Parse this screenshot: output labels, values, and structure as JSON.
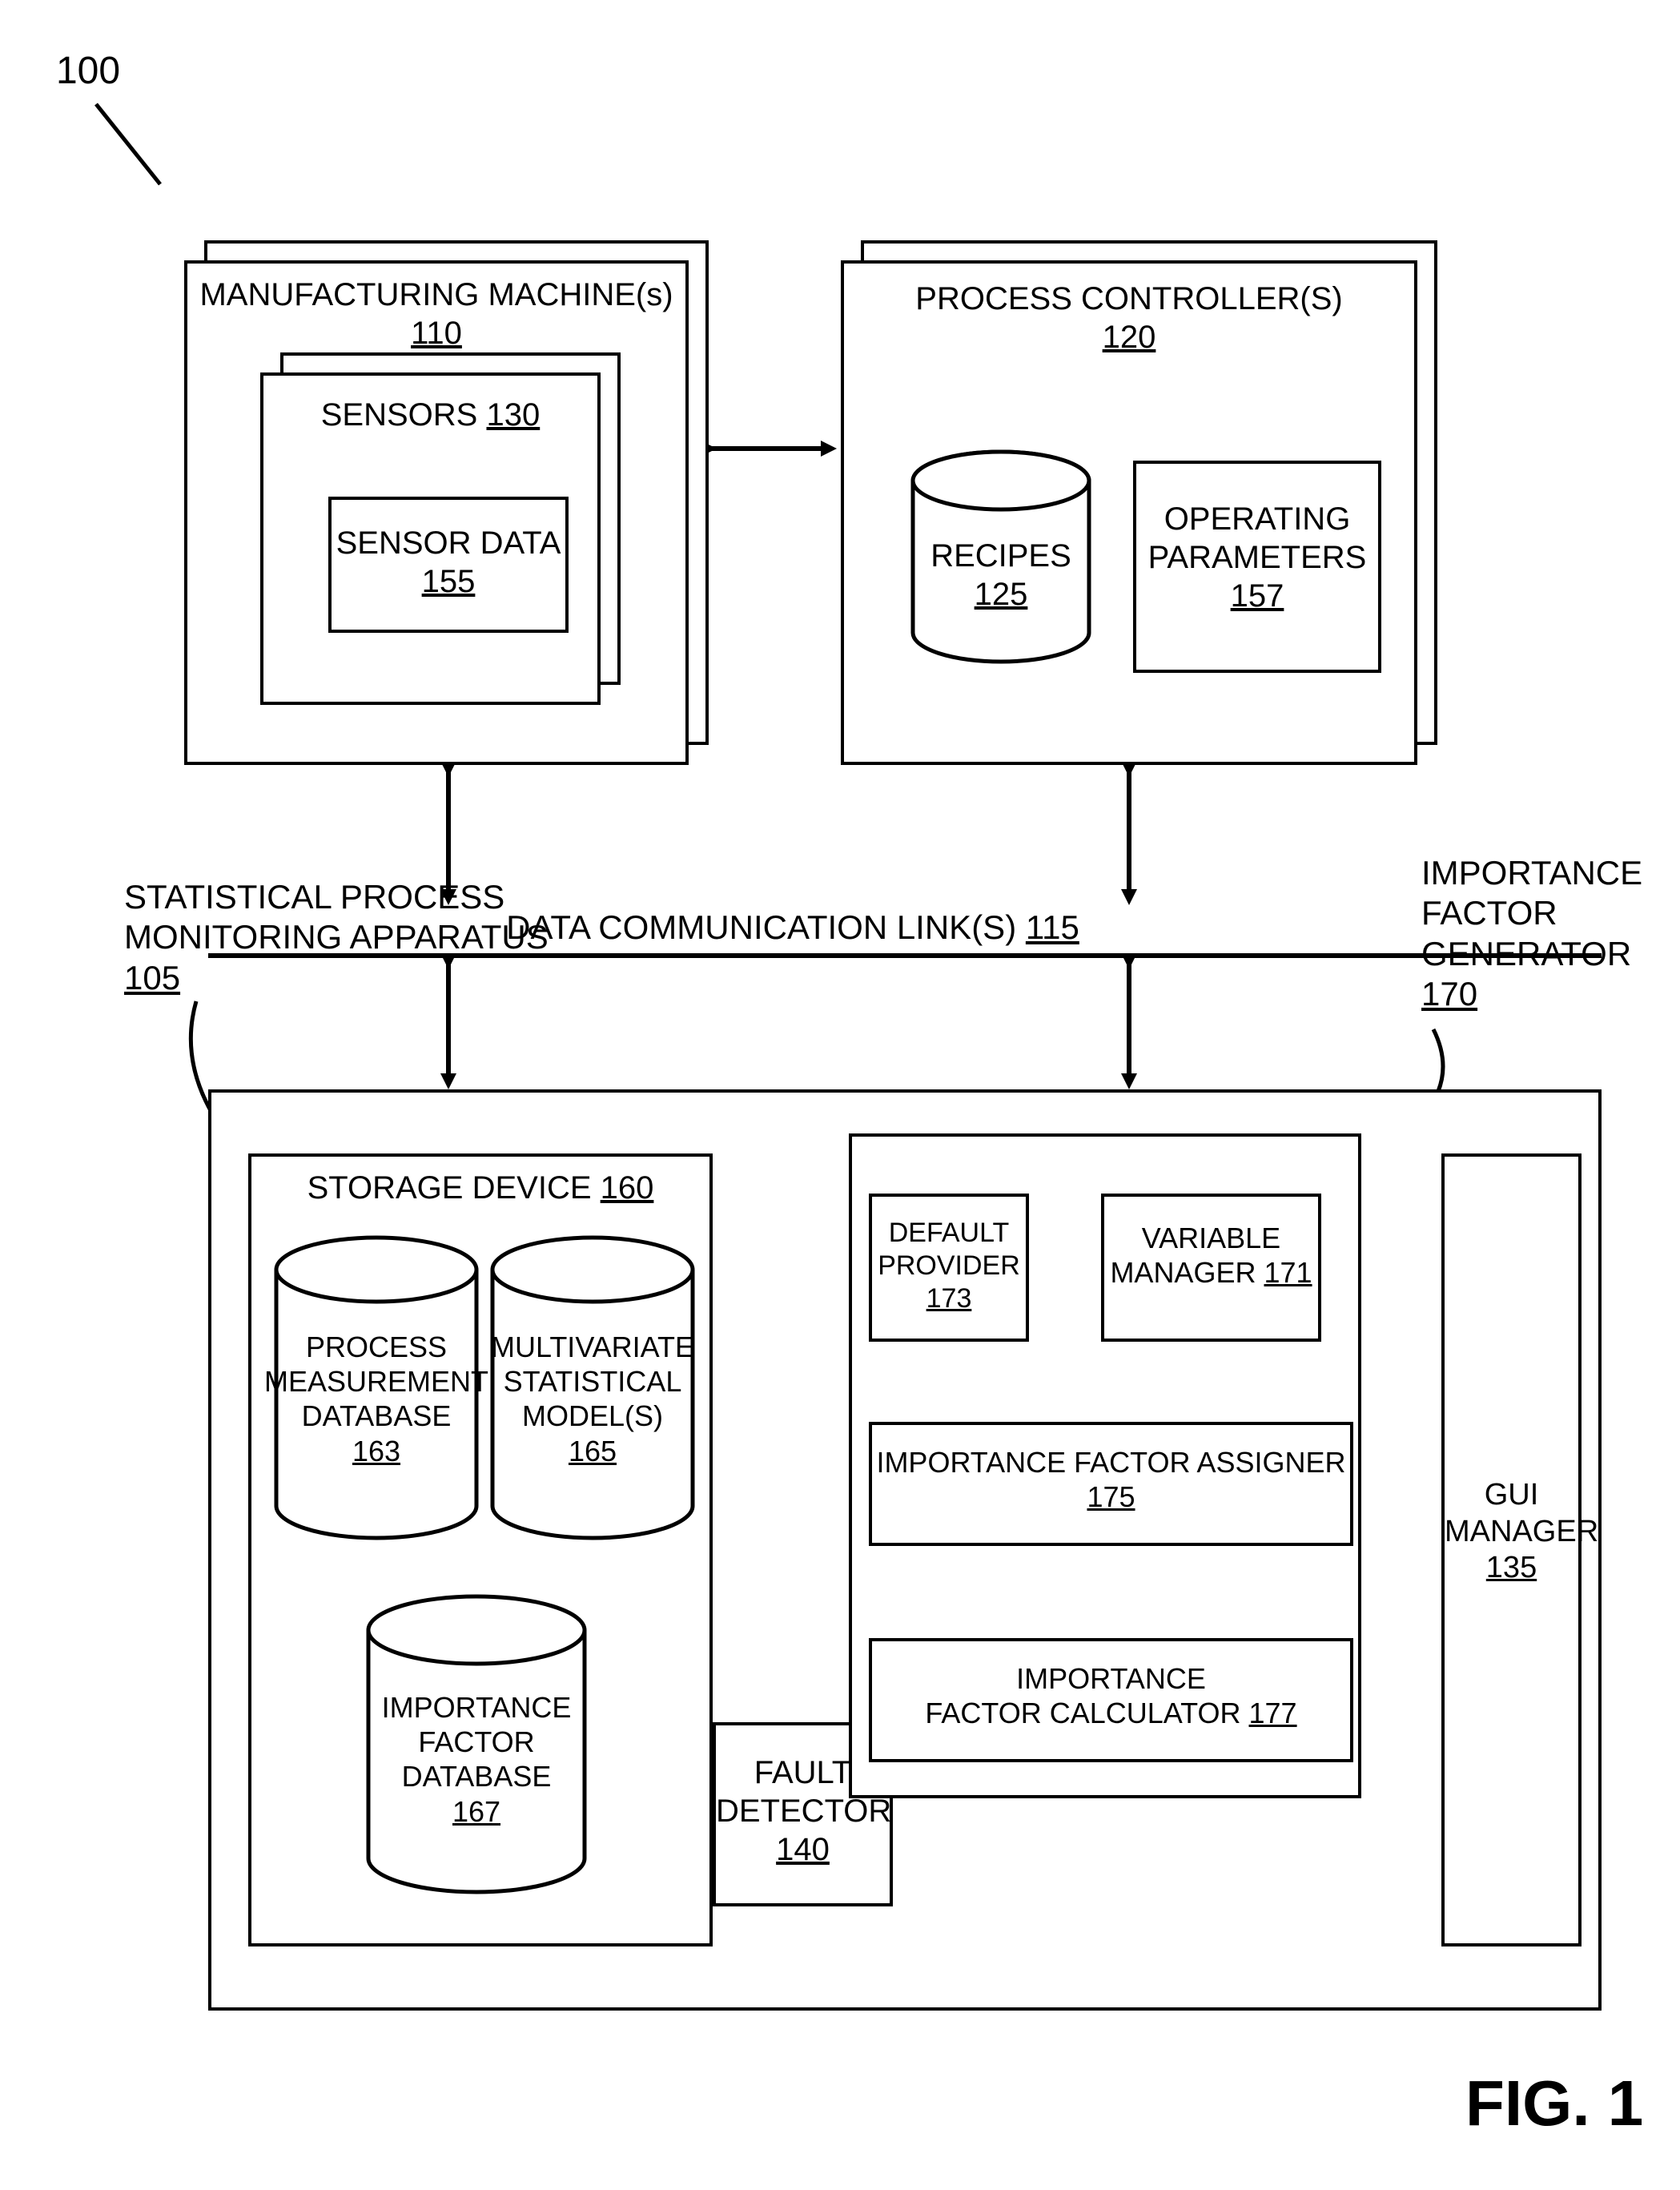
{
  "figure": {
    "ref_number": "100",
    "caption": "FIG. 1"
  },
  "manufacturing_machine": {
    "title_line1": "MANUFACTURING MACHINE(s)",
    "title_ref": "110",
    "sensors": {
      "line1": "SENSORS",
      "ref": "130"
    },
    "sensor_data": {
      "line1": "SENSOR DATA",
      "ref": "155"
    }
  },
  "process_controller": {
    "title": "PROCESS CONTROLLER(S)",
    "ref": "120",
    "recipes": {
      "label": "RECIPES",
      "ref": "125"
    },
    "operating_params": {
      "line1": "OPERATING",
      "line2": "PARAMETERS",
      "ref": "157"
    }
  },
  "link": {
    "label": "DATA COMMUNICATION LINK(S)",
    "ref": "115"
  },
  "spm": {
    "label_line1": "STATISTICAL PROCESS",
    "label_line2": "MONITORING APPARATUS",
    "ref": "105"
  },
  "ifg_callout": {
    "line1": "IMPORTANCE",
    "line2": "FACTOR",
    "line3": "GENERATOR",
    "ref": "170"
  },
  "storage": {
    "title": "STORAGE DEVICE",
    "ref": "160",
    "pmd": {
      "l1": "PROCESS",
      "l2": "MEASUREMENT",
      "l3": "DATABASE",
      "ref": "163"
    },
    "msm": {
      "l1": "MULTIVARIATE",
      "l2": "STATISTICAL",
      "l3": "MODEL(S)",
      "ref": "165"
    },
    "ifd": {
      "l1": "IMPORTANCE",
      "l2": "FACTOR",
      "l3": "DATABASE",
      "ref": "167"
    }
  },
  "fault_detector": {
    "l1": "FAULT",
    "l2": "DETECTOR",
    "ref": "140"
  },
  "ifg_box": {
    "variable_manager": {
      "l1": "VARIABLE",
      "l2": "MANAGER",
      "ref": "171"
    },
    "default_provider": {
      "l1": "DEFAULT",
      "l2": "PROVIDER",
      "ref": "173"
    },
    "if_assigner": {
      "l1": "IMPORTANCE FACTOR ASSIGNER",
      "ref": "175"
    },
    "if_calculator": {
      "l1": "IMPORTANCE",
      "l2": "FACTOR CALCULATOR",
      "ref": "177"
    }
  },
  "gui": {
    "l1": "GUI",
    "l2": "MANAGER",
    "ref": "135"
  }
}
